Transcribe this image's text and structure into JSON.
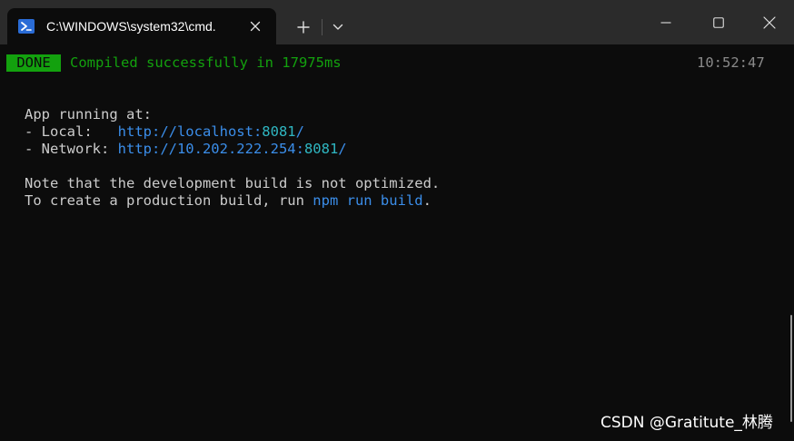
{
  "window": {
    "tab_title": "C:\\WINDOWS\\system32\\cmd.",
    "icons": {
      "tab": "powershell-icon",
      "tab_close": "close-icon",
      "new_tab": "plus-icon",
      "dropdown": "chevron-down-icon",
      "minimize": "minimize-icon",
      "maximize": "maximize-icon",
      "close": "close-icon"
    }
  },
  "terminal": {
    "status_badge": "DONE",
    "compiled_message": "Compiled successfully in 17975ms",
    "timestamp": "10:52:47",
    "app_running": "App running at:",
    "local_label": "- Local:   ",
    "local_url_base": "http://localhost:",
    "local_port": "8081",
    "local_suffix": "/",
    "network_label": "- Network: ",
    "network_url_base": "http://10.202.222.254:",
    "network_port": "8081",
    "network_suffix": "/",
    "note_line": "Note that the development build is not optimized.",
    "prod_prefix": "To create a production build, run ",
    "prod_command": "npm run build",
    "prod_suffix": "."
  },
  "watermark": "CSDN @Gratitute_林腾",
  "colors": {
    "background": "#0c0c0c",
    "titlebar": "#2b2b2b",
    "green": "#13a10e",
    "blue": "#3b8eea",
    "cyan": "#2fb7c2"
  }
}
